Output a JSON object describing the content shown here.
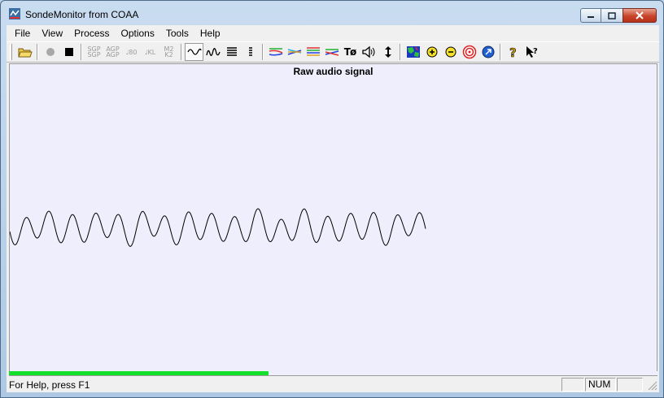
{
  "window": {
    "title": "SondeMonitor from COAA"
  },
  "menu": [
    "File",
    "View",
    "Process",
    "Options",
    "Tools",
    "Help"
  ],
  "toolbar": {
    "sgp": [
      "SGP",
      "SGP"
    ],
    "agp": [
      "AGP",
      "AGP"
    ],
    "v80": "80",
    "kl": "KL",
    "m2k2": [
      "M2",
      "K2"
    ],
    "tphi": "Tø"
  },
  "plot": {
    "title": "Raw audio signal"
  },
  "progress": {
    "value_percent": 40
  },
  "status": {
    "help_text": "For Help, press F1",
    "num": "NUM"
  },
  "colors": {
    "plot_bg": "#eeeefc",
    "progress": "#12e02a",
    "accent": "#3a6ea5"
  }
}
